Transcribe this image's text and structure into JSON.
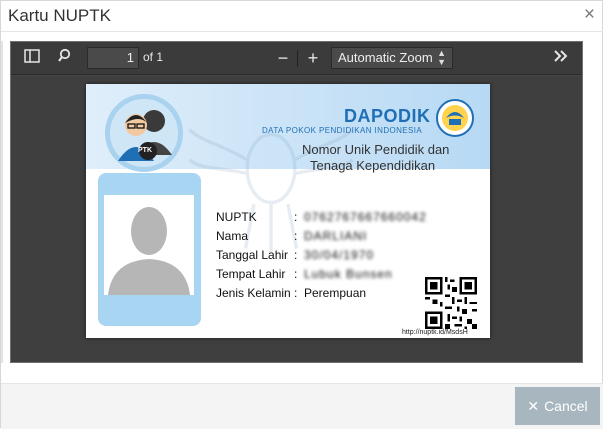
{
  "dialog": {
    "title": "Kartu NUPTK",
    "close_label": "×"
  },
  "toolbar": {
    "page_number": "1",
    "page_count_label": "of 1",
    "zoom_out_label": "−",
    "zoom_in_label": "+",
    "zoom_value": "Automatic Zoom"
  },
  "card": {
    "brand": "DAPODIK",
    "brand_sub": "DATA POKOK PENDIDIKAN INDONESIA",
    "heading_line1": "Nomor Unik Pendidik dan",
    "heading_line2": "Tenaga Kependidikan",
    "avatar_badge": "PTK",
    "fields": [
      {
        "label": "NUPTK",
        "value": "0762767667660042",
        "redacted": true
      },
      {
        "label": "Nama",
        "value": "DARLIANI",
        "redacted": true
      },
      {
        "label": "Tanggal Lahir",
        "value": "30/04/1970",
        "redacted": true
      },
      {
        "label": "Tempat Lahir",
        "value": "Lubuk Bunsen",
        "redacted": true
      },
      {
        "label": "Jenis Kelamin",
        "value": "Perempuan",
        "redacted": false
      }
    ],
    "qr_url": "http://nuptk.id/MsdsH"
  },
  "footer": {
    "cancel_label": "Cancel"
  },
  "colors": {
    "brand_blue": "#1f6fb6",
    "card_blue": "#a8d5f2",
    "viewer_bg": "#464646",
    "cancel_bg": "#a8b6bf"
  },
  "icons": {
    "sidebar_toggle": "sidebar-toggle-icon",
    "search": "search-icon",
    "presentation": "double-chevron-right-icon",
    "close": "close-icon"
  }
}
